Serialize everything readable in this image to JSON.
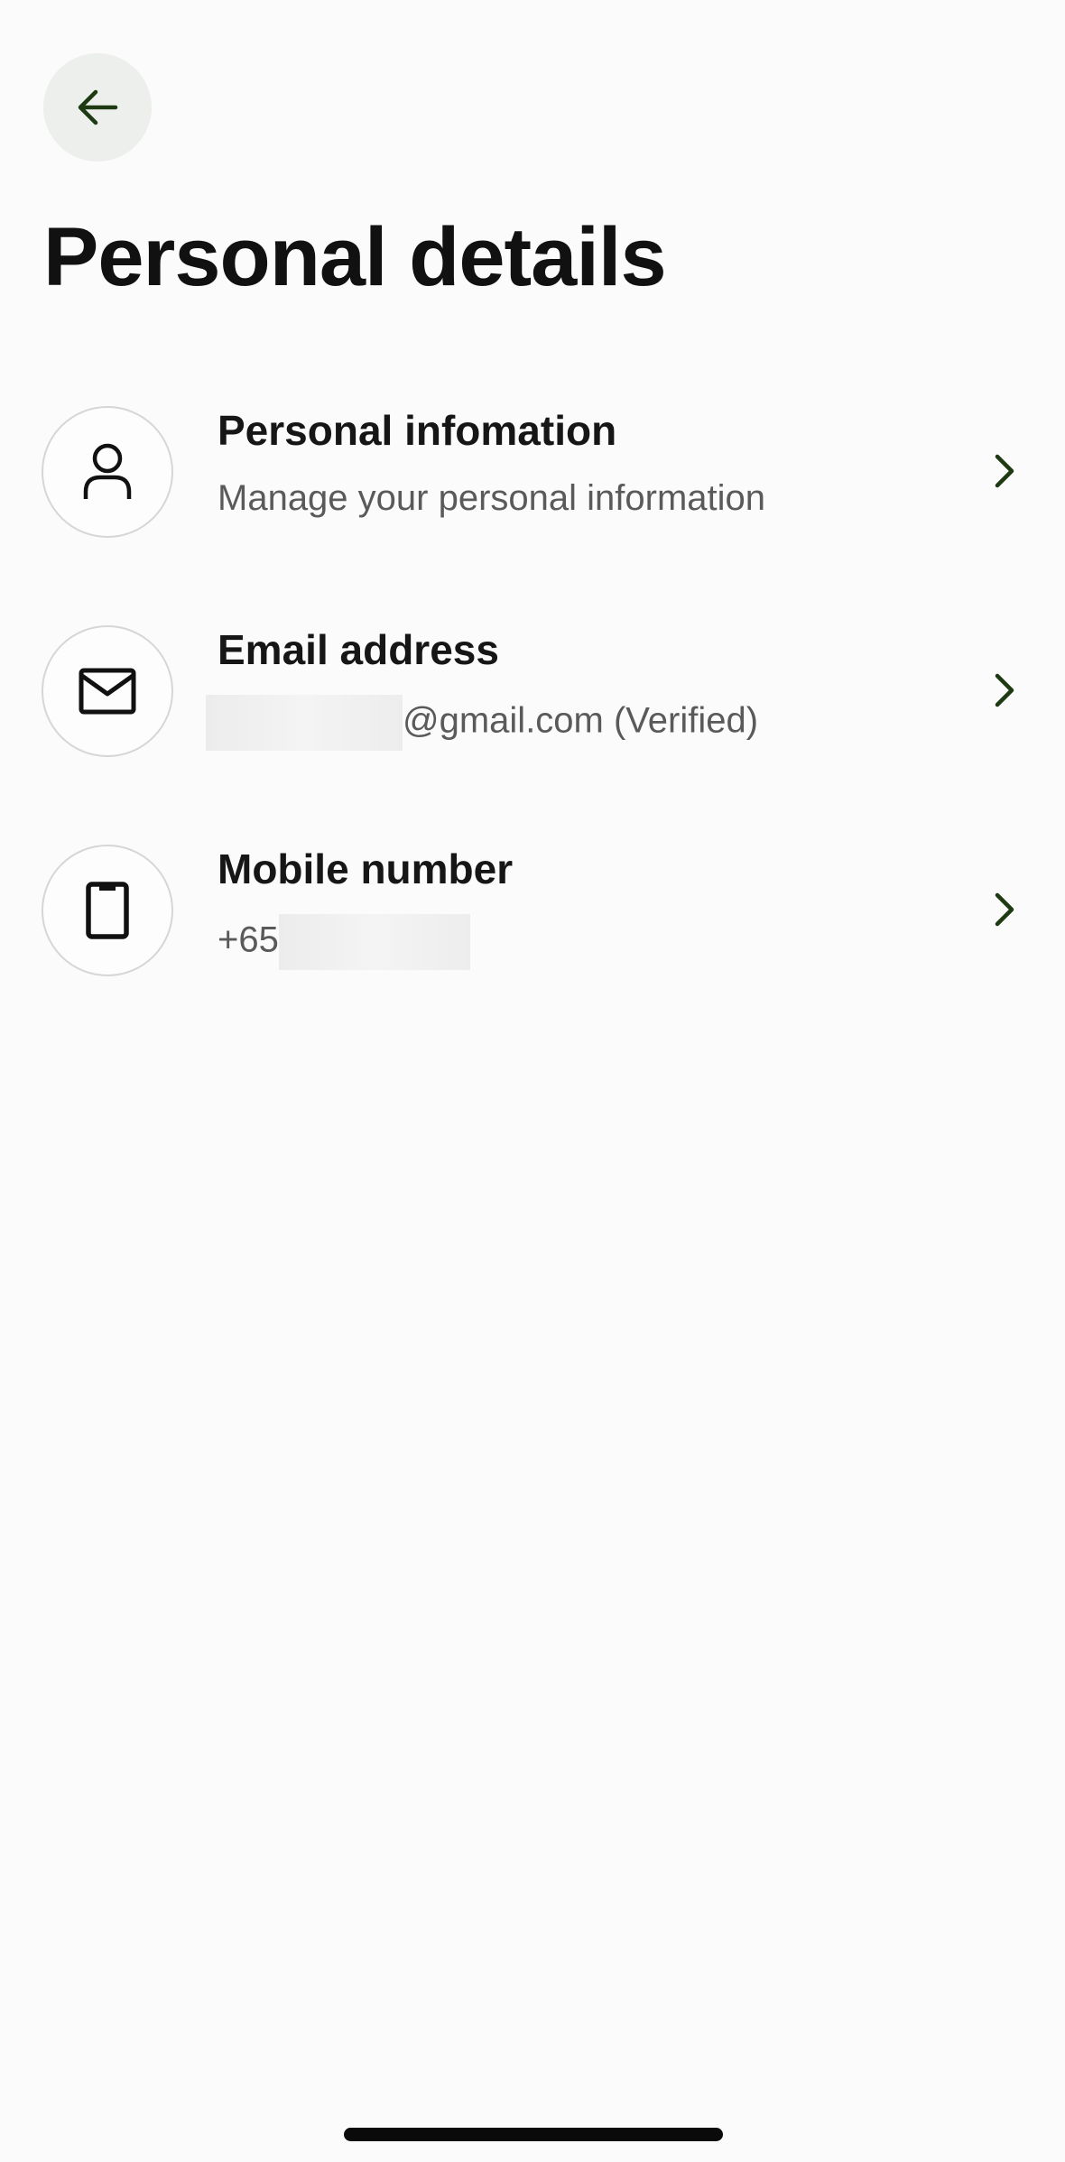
{
  "header": {
    "title": "Personal details"
  },
  "items": [
    {
      "icon": "person-icon",
      "title": "Personal infomation",
      "subtitle": "Manage your personal information"
    },
    {
      "icon": "mail-icon",
      "title": "Email address",
      "subtitle": "@gmail.com (Verified)"
    },
    {
      "icon": "phone-icon",
      "title": "Mobile number",
      "subtitle": "+65"
    }
  ],
  "colors": {
    "background": "#fcfbfb",
    "back_button_bg": "#edefec",
    "accent_dark_green": "#1d3a12",
    "text_primary": "#161616",
    "text_secondary": "#5a5a5a"
  }
}
